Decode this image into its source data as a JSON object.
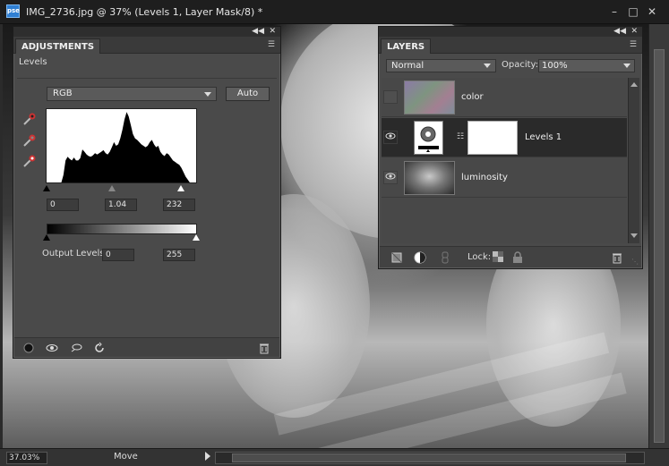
{
  "window": {
    "title": "IMG_2736.jpg @ 37% (Levels 1, Layer Mask/8) *",
    "app_icon": "pse",
    "controls": [
      "minimize-icon",
      "maximize-icon",
      "close-icon"
    ]
  },
  "adjustments": {
    "tab": "ADJUSTMENTS",
    "subtitle": "Levels",
    "channel": "RGB",
    "auto_label": "Auto",
    "input_levels": {
      "black": "0",
      "gamma": "1.04",
      "white": "232"
    },
    "output_label": "Output Levels:",
    "output_levels": {
      "black": "0",
      "white": "255"
    },
    "histogram_shape": [
      0,
      0,
      0,
      0,
      0,
      0,
      0,
      0,
      0.1,
      0.3,
      0.35,
      0.32,
      0.3,
      0.34,
      0.3,
      0.3,
      0.33,
      0.45,
      0.42,
      0.38,
      0.36,
      0.35,
      0.37,
      0.4,
      0.38,
      0.4,
      0.42,
      0.44,
      0.4,
      0.38,
      0.42,
      0.48,
      0.55,
      0.5,
      0.52,
      0.6,
      0.72,
      0.86,
      0.96,
      0.9,
      0.78,
      0.66,
      0.6,
      0.58,
      0.55,
      0.52,
      0.5,
      0.48,
      0.5,
      0.55,
      0.58,
      0.52,
      0.48,
      0.5,
      0.42,
      0.38,
      0.36,
      0.4,
      0.38,
      0.34,
      0.3,
      0.28,
      0.26,
      0.24,
      0.2,
      0.14,
      0.08,
      0.04,
      0,
      0,
      0,
      0
    ],
    "footer_icons": [
      "clip-to-layer-icon",
      "visibility-icon",
      "view-previous-icon",
      "reset-icon",
      "trash-icon"
    ]
  },
  "layers": {
    "tab": "LAYERS",
    "blend_mode": "Normal",
    "opacity_label": "Opacity:",
    "opacity_value": "100%",
    "items": [
      {
        "name": "color",
        "visible": false,
        "selected": false,
        "thumb_color": "#8a7a9c"
      },
      {
        "name": "Levels 1",
        "visible": true,
        "selected": true,
        "has_mask": true
      },
      {
        "name": "luminosity",
        "visible": true,
        "selected": false,
        "thumb_color": "#7a7a7a"
      }
    ],
    "lock_label": "Lock:",
    "footer_icons": [
      "new-layer-icon",
      "adjustment-layer-icon",
      "link-icon",
      "lock-transparency-icon",
      "lock-all-icon",
      "trash-icon"
    ]
  },
  "status": {
    "zoom": "37.03%",
    "tool": "Move"
  }
}
